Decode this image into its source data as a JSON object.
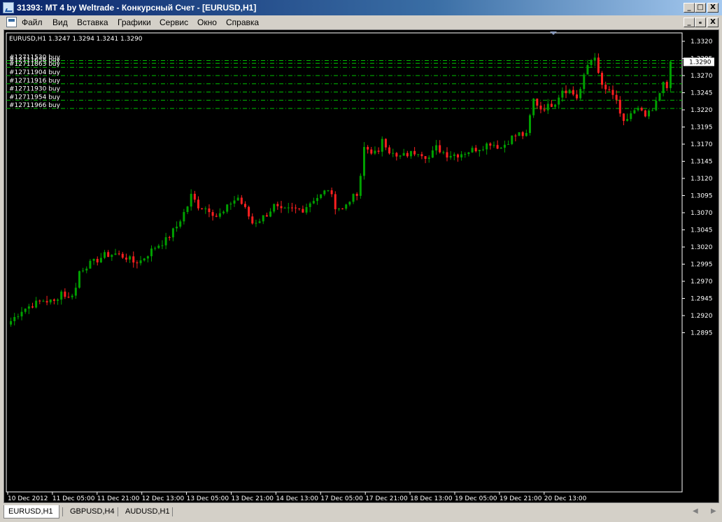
{
  "window": {
    "title": "31393: MT 4 by Weltrade - Конкурсный Счет - [EURUSD,H1]",
    "minimize": "_",
    "maximize": "□",
    "close": "X",
    "mdi_minimize": "_",
    "mdi_restore": "ₑ",
    "mdi_close": "X"
  },
  "menu": [
    "Файл",
    "Вид",
    "Вставка",
    "Графики",
    "Сервис",
    "Окно",
    "Справка"
  ],
  "chart_data": {
    "type": "candlestick",
    "title": "EURUSD,H1  1.3247 1.3294 1.3241 1.3290",
    "symbol": "EURUSD",
    "timeframe": "H1",
    "ohlc_last": {
      "open": 1.3247,
      "high": 1.3294,
      "low": 1.3241,
      "close": 1.329
    },
    "current_price": "1.3290",
    "ylim": [
      1.2885,
      1.333
    ],
    "y_ticks": [
      "1.3320",
      "1.3295",
      "1.3270",
      "1.3245",
      "1.3220",
      "1.3195",
      "1.3170",
      "1.3145",
      "1.3120",
      "1.3095",
      "1.3070",
      "1.3045",
      "1.3020",
      "1.2995",
      "1.2970",
      "1.2945",
      "1.2920",
      "1.2895"
    ],
    "x_ticks": [
      "10 Dec 2012",
      "11 Dec 05:00",
      "11 Dec 21:00",
      "12 Dec 13:00",
      "13 Dec 05:00",
      "13 Dec 21:00",
      "14 Dec 13:00",
      "17 Dec 05:00",
      "17 Dec 21:00",
      "18 Dec 13:00",
      "19 Dec 05:00",
      "19 Dec 21:00",
      "20 Dec 13:00"
    ],
    "grid": false,
    "colors": {
      "background": "#000000",
      "bull": "#00a000",
      "bear": "#ff2020",
      "order_line": "#00c000",
      "text": "#ffffff"
    },
    "orders": [
      {
        "label": "#12711530 buy",
        "price": 1.3292
      },
      {
        "label": "#12711658 buy",
        "price": 1.3288
      },
      {
        "label": "#12711863 buy",
        "price": 1.3282
      },
      {
        "label": "#12711904 buy",
        "price": 1.327
      },
      {
        "label": "#12711916 buy",
        "price": 1.3258
      },
      {
        "label": "#12711930 buy",
        "price": 1.3246
      },
      {
        "label": "#12711954 buy",
        "price": 1.3234
      },
      {
        "label": "#12711966 buy",
        "price": 1.3222
      }
    ],
    "close_path": [
      {
        "bar": 0,
        "close": 1.2912
      },
      {
        "bar": 3,
        "close": 1.2928
      },
      {
        "bar": 6,
        "close": 1.2936
      },
      {
        "bar": 9,
        "close": 1.2942
      },
      {
        "bar": 12,
        "close": 1.294
      },
      {
        "bar": 14,
        "close": 1.2955
      },
      {
        "bar": 16,
        "close": 1.2945
      },
      {
        "bar": 18,
        "close": 1.296
      },
      {
        "bar": 19,
        "close": 1.2985
      },
      {
        "bar": 21,
        "close": 1.2993
      },
      {
        "bar": 23,
        "close": 1.2998
      },
      {
        "bar": 26,
        "close": 1.3008
      },
      {
        "bar": 29,
        "close": 1.301
      },
      {
        "bar": 32,
        "close": 1.3005
      },
      {
        "bar": 34,
        "close": 1.2998
      },
      {
        "bar": 36,
        "close": 1.3
      },
      {
        "bar": 38,
        "close": 1.301
      },
      {
        "bar": 40,
        "close": 1.302
      },
      {
        "bar": 43,
        "close": 1.303
      },
      {
        "bar": 46,
        "close": 1.305
      },
      {
        "bar": 49,
        "close": 1.308
      },
      {
        "bar": 50,
        "close": 1.3095
      },
      {
        "bar": 52,
        "close": 1.308
      },
      {
        "bar": 55,
        "close": 1.3075
      },
      {
        "bar": 57,
        "close": 1.3065
      },
      {
        "bar": 59,
        "close": 1.307
      },
      {
        "bar": 61,
        "close": 1.3085
      },
      {
        "bar": 63,
        "close": 1.3092
      },
      {
        "bar": 65,
        "close": 1.3075
      },
      {
        "bar": 67,
        "close": 1.3055
      },
      {
        "bar": 69,
        "close": 1.306
      },
      {
        "bar": 71,
        "close": 1.3068
      },
      {
        "bar": 73,
        "close": 1.308
      },
      {
        "bar": 75,
        "close": 1.3072
      },
      {
        "bar": 78,
        "close": 1.3075
      },
      {
        "bar": 81,
        "close": 1.3075
      },
      {
        "bar": 84,
        "close": 1.309
      },
      {
        "bar": 86,
        "close": 1.3095
      },
      {
        "bar": 88,
        "close": 1.3105
      },
      {
        "bar": 90,
        "close": 1.308
      },
      {
        "bar": 92,
        "close": 1.3075
      },
      {
        "bar": 94,
        "close": 1.309
      },
      {
        "bar": 96,
        "close": 1.3095
      },
      {
        "bar": 97,
        "close": 1.312
      },
      {
        "bar": 98,
        "close": 1.3165
      },
      {
        "bar": 100,
        "close": 1.316
      },
      {
        "bar": 102,
        "close": 1.3155
      },
      {
        "bar": 103,
        "close": 1.318
      },
      {
        "bar": 105,
        "close": 1.316
      },
      {
        "bar": 107,
        "close": 1.315
      },
      {
        "bar": 110,
        "close": 1.3155
      },
      {
        "bar": 113,
        "close": 1.316
      },
      {
        "bar": 116,
        "close": 1.315
      },
      {
        "bar": 118,
        "close": 1.3165
      },
      {
        "bar": 121,
        "close": 1.3155
      },
      {
        "bar": 124,
        "close": 1.3155
      },
      {
        "bar": 127,
        "close": 1.316
      },
      {
        "bar": 130,
        "close": 1.3165
      },
      {
        "bar": 133,
        "close": 1.3172
      },
      {
        "bar": 136,
        "close": 1.3165
      },
      {
        "bar": 139,
        "close": 1.318
      },
      {
        "bar": 141,
        "close": 1.3185
      },
      {
        "bar": 143,
        "close": 1.3182
      },
      {
        "bar": 144,
        "close": 1.321
      },
      {
        "bar": 145,
        "close": 1.3235
      },
      {
        "bar": 147,
        "close": 1.3222
      },
      {
        "bar": 149,
        "close": 1.3225
      },
      {
        "bar": 151,
        "close": 1.3232
      },
      {
        "bar": 153,
        "close": 1.325
      },
      {
        "bar": 155,
        "close": 1.3248
      },
      {
        "bar": 157,
        "close": 1.3238
      },
      {
        "bar": 158,
        "close": 1.325
      },
      {
        "bar": 160,
        "close": 1.3285
      },
      {
        "bar": 162,
        "close": 1.33
      },
      {
        "bar": 163,
        "close": 1.327
      },
      {
        "bar": 164,
        "close": 1.3255
      },
      {
        "bar": 166,
        "close": 1.3245
      },
      {
        "bar": 168,
        "close": 1.3235
      },
      {
        "bar": 169,
        "close": 1.321
      },
      {
        "bar": 170,
        "close": 1.32
      },
      {
        "bar": 172,
        "close": 1.3215
      },
      {
        "bar": 174,
        "close": 1.322
      },
      {
        "bar": 176,
        "close": 1.321
      },
      {
        "bar": 178,
        "close": 1.3218
      },
      {
        "bar": 179,
        "close": 1.323
      },
      {
        "bar": 180,
        "close": 1.3245
      },
      {
        "bar": 181,
        "close": 1.3265
      },
      {
        "bar": 182,
        "close": 1.3247
      },
      {
        "bar": 183,
        "close": 1.329
      }
    ]
  },
  "tabs": [
    "EURUSD,H1",
    "GBPUSD,H4",
    "AUDUSD,H1"
  ],
  "active_tab": "EURUSD,H1"
}
